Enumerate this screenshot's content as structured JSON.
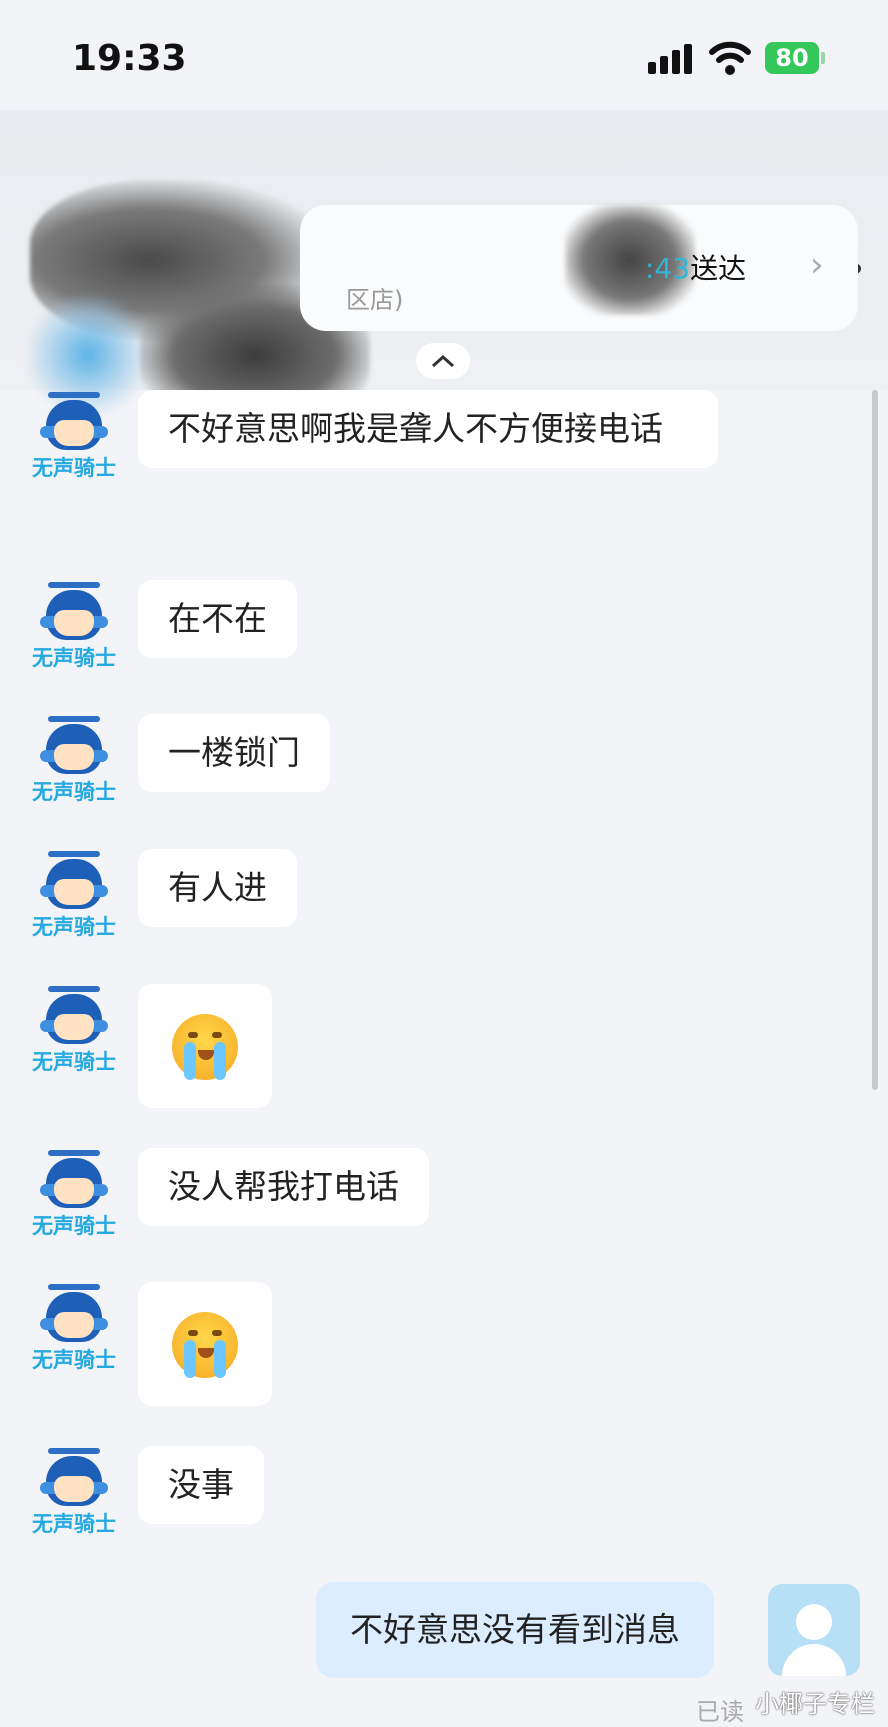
{
  "status_bar": {
    "time": "19:33",
    "battery": "80"
  },
  "header": {
    "order_eta_time": ":43",
    "order_eta_status": "送达",
    "store_suffix": "区店)"
  },
  "rider_label": "无声骑士",
  "messages": [
    {
      "text": "不好意思啊我是聋人不方便接电话"
    },
    {
      "text": "在不在"
    },
    {
      "text": "一楼锁门"
    },
    {
      "text": "有人进"
    },
    {
      "emoji": "crying-face"
    },
    {
      "text": "没人帮我打电话"
    },
    {
      "emoji": "crying-face"
    },
    {
      "text": "没事"
    }
  ],
  "self_message": {
    "text": "不好意思没有看到消息",
    "status": "已读"
  },
  "watermark": "小椰子专栏"
}
